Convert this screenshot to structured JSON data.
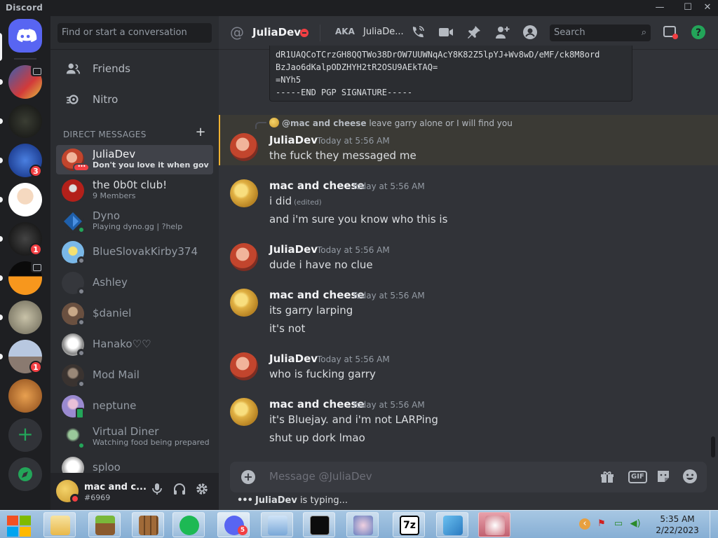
{
  "window": {
    "title": "Discord",
    "controls": [
      "—",
      "☐",
      "✕"
    ]
  },
  "servers": {
    "home_icon": "discord-logo-icon",
    "list": [
      {
        "name": "server-1",
        "color": "#3a5fb0",
        "badge": "",
        "video": true
      },
      {
        "name": "server-2",
        "color": "#1d1f1b",
        "badge": "",
        "video": false
      },
      {
        "name": "linux-shop",
        "color": "#1f4fb8",
        "badge": "3",
        "video": false
      },
      {
        "name": "peter-griffin",
        "color": "#e8e8e8",
        "badge": "",
        "video": false
      },
      {
        "name": "akiz-bot",
        "color": "#111111",
        "badge": "1",
        "video": false
      },
      {
        "name": "hub-server",
        "color": "#0a0a0a",
        "badge": "",
        "video": true
      },
      {
        "name": "server-7",
        "color": "#9a9580",
        "badge": "",
        "video": false
      },
      {
        "name": "server-8",
        "color": "#8090a8",
        "badge": "1",
        "video": false
      },
      {
        "name": "burger-server",
        "color": "#c98a3a",
        "badge": "",
        "video": false
      }
    ],
    "add_icon": "plus-icon",
    "explore_icon": "compass-icon"
  },
  "sidebar": {
    "search_placeholder": "Find or start a conversation",
    "nav": [
      {
        "label": "Friends",
        "icon": "friends-icon"
      },
      {
        "label": "Nitro",
        "icon": "nitro-icon"
      }
    ],
    "dm_header": "DIRECT MESSAGES",
    "dms": [
      {
        "name": "JuliaDev",
        "sub": "Don't you love it when govern...",
        "status": "typing",
        "color": "#c2452d",
        "active": true
      },
      {
        "name": "the 0b0t club!",
        "sub": "9 Members",
        "status": "",
        "color": "#b3201a",
        "active": false
      },
      {
        "name": "Dyno",
        "sub": "Playing dyno.gg | ?help",
        "status": "online",
        "color": "#1f5faa",
        "active": false
      },
      {
        "name": "BlueSlovakKirby374",
        "sub": "",
        "status": "offline",
        "color": "#7ab8e8",
        "active": false
      },
      {
        "name": "Ashley",
        "sub": "",
        "status": "offline",
        "color": "#35373c",
        "active": false
      },
      {
        "name": "$daniel",
        "sub": "",
        "status": "offline",
        "color": "#6a5040",
        "active": false
      },
      {
        "name": "Hanako♡♡",
        "sub": "",
        "status": "offline",
        "color": "#e0e0e0",
        "active": false
      },
      {
        "name": "Mod Mail",
        "sub": "",
        "status": "offline",
        "color": "#555555",
        "active": false
      },
      {
        "name": "neptune",
        "sub": "",
        "status": "mobile",
        "color": "#9a8ad0",
        "active": false
      },
      {
        "name": "Virtual Diner",
        "sub": "Watching food being prepared!",
        "status": "online",
        "color": "#3a6a3a",
        "active": false
      },
      {
        "name": "sploo",
        "sub": "",
        "status": "",
        "color": "#dddddd",
        "active": false
      }
    ]
  },
  "user_panel": {
    "name": "mac and c...",
    "tag": "#6969",
    "mic_icon": "microphone-icon",
    "headset_icon": "headphones-icon",
    "settings_icon": "gear-icon"
  },
  "chat_header": {
    "at_symbol": "@",
    "name": "JuliaDev",
    "aka_label": "AKA",
    "aka_name": "JuliaDe...",
    "search_placeholder": "Search",
    "icons": [
      "call-icon",
      "video-icon",
      "pin-icon",
      "add-friend-icon",
      "profile-icon",
      "inbox-icon",
      "help-icon"
    ]
  },
  "pgp_block": [
    "dR1UAQCoTCrzGH8QQTWo38DrOW7UUWNqAcY8K82Z5lpYJ+Wv8wD/eMF/ck8M8ord",
    "BzJao6dKalpODZHYH2tR2OSU9AEkTAQ=",
    "=NYh5",
    "-----END PGP SIGNATURE-----"
  ],
  "reply": {
    "mention": "@mac and cheese",
    "text": "leave garry alone or I will find you"
  },
  "messages": [
    {
      "author": "JuliaDev",
      "time": "Today at 5:56 AM",
      "avatar": "julia",
      "lines": [
        "the fuck they messaged me"
      ]
    },
    {
      "author": "mac and cheese",
      "time": "Today at 5:56 AM",
      "avatar": "mac",
      "lines": [
        "i did",
        "and i'm sure you know who this is"
      ],
      "edited": "(edited)"
    },
    {
      "author": "JuliaDev",
      "time": "Today at 5:56 AM",
      "avatar": "julia",
      "lines": [
        "dude i have no clue"
      ]
    },
    {
      "author": "mac and cheese",
      "time": "Today at 5:56 AM",
      "avatar": "mac",
      "lines": [
        "its garry larping",
        "it's not"
      ]
    },
    {
      "author": "JuliaDev",
      "time": "Today at 5:56 AM",
      "avatar": "julia",
      "lines": [
        "who is fucking garry"
      ]
    },
    {
      "author": "mac and cheese",
      "time": "Today at 5:56 AM",
      "avatar": "mac",
      "lines": [
        "it's Bluejay. and i'm not LARPing",
        "shut up dork lmao"
      ]
    }
  ],
  "composer": {
    "placeholder": "Message @JuliaDev",
    "gif_label": "GIF",
    "icons": [
      "gift-icon",
      "gif-icon",
      "sticker-icon",
      "emoji-icon"
    ]
  },
  "typing": {
    "name": "JuliaDev",
    "suffix": "is typing..."
  },
  "taskbar": {
    "apps": [
      {
        "name": "file-explorer",
        "color": "#f2d77a",
        "badge": ""
      },
      {
        "name": "minecraft-launcher",
        "color": "#6b9a3a",
        "badge": ""
      },
      {
        "name": "crafting-table",
        "color": "#8a5a2e",
        "badge": ""
      },
      {
        "name": "spotify",
        "color": "#1db954",
        "badge": ""
      },
      {
        "name": "discord",
        "color": "#5865f2",
        "badge": "5"
      },
      {
        "name": "remote-desktop",
        "color": "#7aa8d8",
        "badge": ""
      },
      {
        "name": "command-prompt",
        "color": "#0c0c0c",
        "badge": ""
      },
      {
        "name": "game-app",
        "color": "#9ab0d8",
        "badge": ""
      },
      {
        "name": "7zip",
        "color": "#ffffff",
        "badge": ""
      },
      {
        "name": "vscode",
        "color": "#3b9ad9",
        "badge": ""
      },
      {
        "name": "paint-app",
        "color": "#d07a86",
        "badge": ""
      }
    ],
    "seven_zip_label": "7z",
    "time": "5:35 AM",
    "date": "2/22/2023"
  }
}
